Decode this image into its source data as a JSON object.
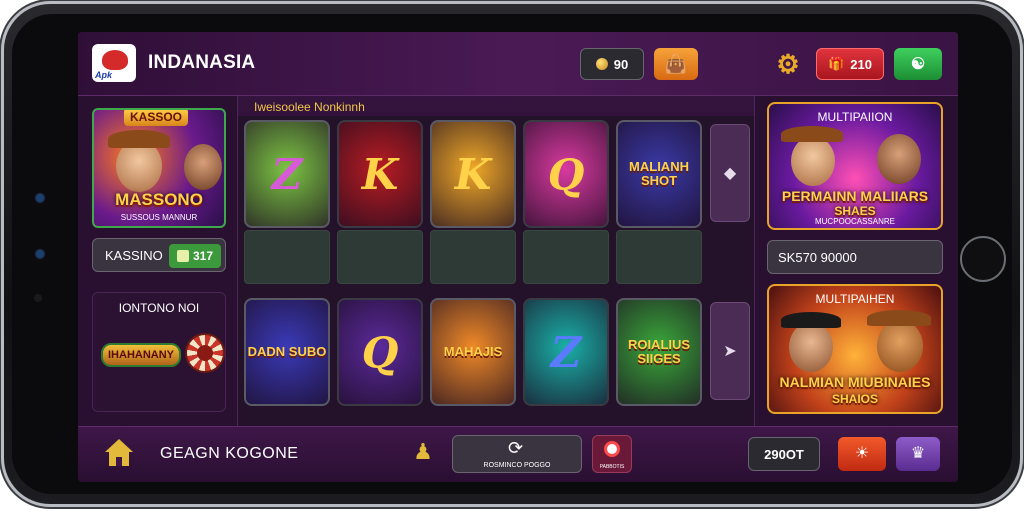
{
  "header": {
    "logo_text": "Apk",
    "brand": "INDANASIA",
    "coins": "90",
    "gift_count": "210"
  },
  "left": {
    "feature_badge": "KASSOO",
    "feature_title": "MASSONO",
    "feature_sub": "SUSSOUS MANNUR",
    "kassino_label": "KASSINO",
    "kassino_value": "317",
    "roulette_title": "IONTONO NOI",
    "roulette_logo": "IHAHANANY"
  },
  "grid": {
    "title": "Iweisoolee Nonkinnh",
    "row1": [
      {
        "glyph": "Z",
        "fg": "#d85ad8",
        "bg": "#7cc443"
      },
      {
        "glyph": "K",
        "fg": "#ffd24a",
        "bg": "#b81c22"
      },
      {
        "glyph": "K",
        "fg": "#ffd24a",
        "bg": "#f0a828"
      },
      {
        "glyph": "Q",
        "fg": "#ffd24a",
        "bg": "#d93aa0"
      },
      {
        "glyph": "MALIANH SHOT",
        "fg": "#ffd24a",
        "bg": "#3a3aa8"
      }
    ],
    "row2": [
      {
        "glyph": "DADN SUBO",
        "fg": "#ffd24a",
        "bg": "#3a3ab8"
      },
      {
        "glyph": "Q",
        "fg": "#ffd24a",
        "bg": "#5a2a9a"
      },
      {
        "glyph": "MAHAJIS",
        "fg": "#ffd24a",
        "bg": "#f08a28"
      },
      {
        "glyph": "Z",
        "fg": "#5a7aff",
        "bg": "#1ab0a8"
      },
      {
        "glyph": "ROIALIUS SIIGES",
        "fg": "#ffd24a",
        "bg": "#3aa83a"
      }
    ]
  },
  "right": {
    "promo1_head": "MULTIPAIION",
    "promo1_title": "PERMAINN MALIIARS",
    "promo1_title2": "SHAES",
    "promo1_sub": "MUCPOOCASSANRE",
    "search_text": "SK570 90000",
    "promo2_head": "MULTIPAIHEN",
    "promo2_title": "NALMIAN MIUBINAIES",
    "promo2_title2": "SHAIOS"
  },
  "footer": {
    "label": "GEAGN KOGONE",
    "refresh_label": "ROSMINCO POGGO",
    "target_label": "PABBOTIS",
    "count": "290OT"
  },
  "icons": {
    "home": "home-icon",
    "settings": "gear-icon",
    "gift": "gift-icon",
    "user": "user-icon",
    "bag": "bag-icon"
  }
}
